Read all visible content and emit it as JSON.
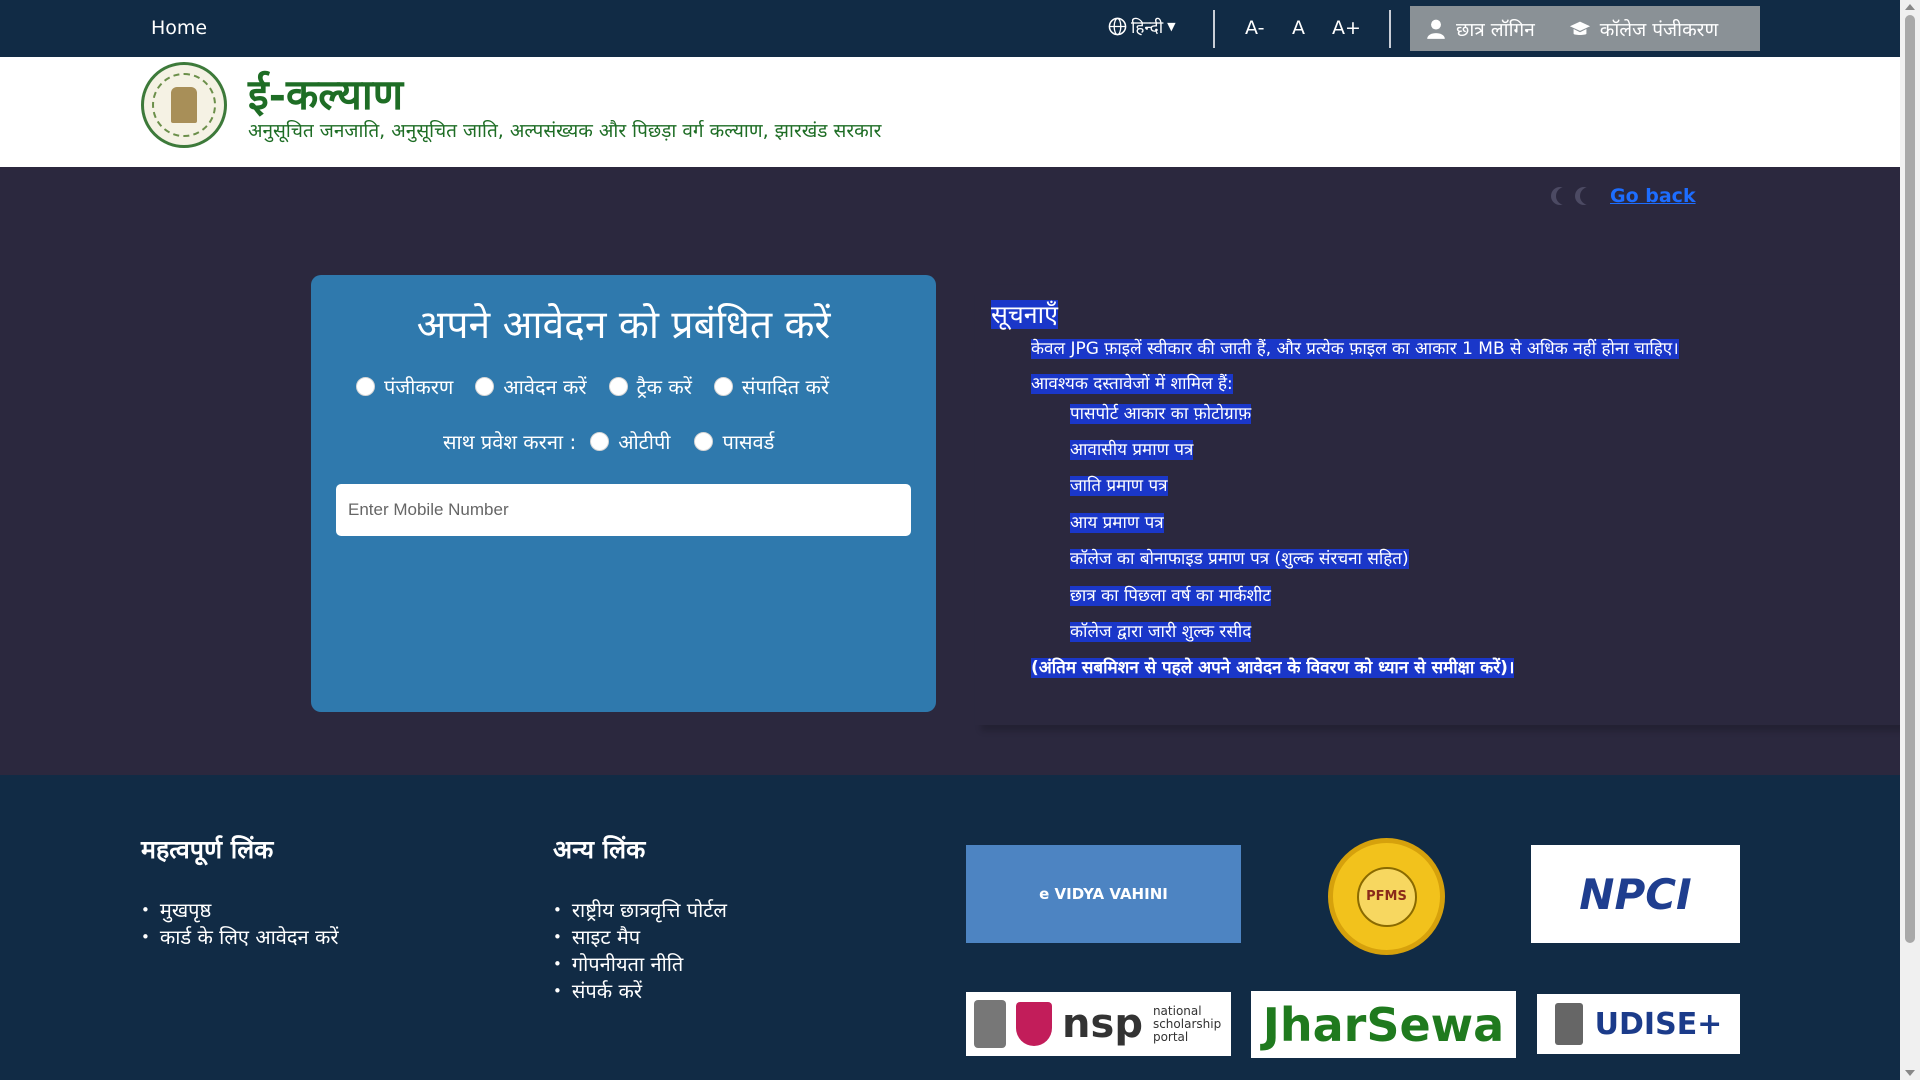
{
  "topbar": {
    "home": "Home",
    "language": "हिन्दी",
    "font_small": "A-",
    "font_normal": "A",
    "font_large": "A+",
    "student_login": "छात्र लॉगिन",
    "college_registration": "कॉलेज पंजीकरण"
  },
  "header": {
    "title": "ई-कल्याण",
    "subtitle": "अनुसूचित जनजाति, अनुसूचित जाति, अल्पसंख्यक और पिछड़ा वर्ग कल्याण, झारखंड सरकार"
  },
  "go_back": "Go back",
  "form": {
    "heading": "अपने आवेदन को प्रबंधित करें",
    "options": [
      "पंजीकरण",
      "आवेदन करें",
      "ट्रैक करें",
      "संपादित करें"
    ],
    "login_with_label": "साथ प्रवेश करना :",
    "login_options": [
      "ओटीपी",
      "पासवर्ड"
    ],
    "mobile_placeholder": "Enter Mobile Number"
  },
  "notices": {
    "heading": "सूचनाएँ",
    "file_note": "केवल JPG फ़ाइलें स्वीकार की जाती हैं, और प्रत्येक फ़ाइल का आकार 1 MB से अधिक नहीं होना चाहिए।",
    "docs_heading": "आवश्यक दस्तावेजों में शामिल हैं:",
    "documents": [
      "पासपोर्ट आकार का फ़ोटोग्राफ़",
      "आवासीय प्रमाण पत्र",
      "जाति प्रमाण पत्र",
      "आय प्रमाण पत्र",
      "कॉलेज का बोनाफाइड प्रमाण पत्र (शुल्क संरचना सहित)",
      "छात्र का पिछला वर्ष का मार्कशीट",
      "कॉलेज द्वारा जारी शुल्क रसीद"
    ],
    "final_note": "(अंतिम सबमिशन से पहले अपने आवेदन के विवरण को ध्यान से समीक्षा करें)।"
  },
  "footer": {
    "important_links_heading": "महत्वपूर्ण लिंक",
    "important_links": [
      "मुखपृष्ठ",
      "कार्ड के लिए आवेदन करें"
    ],
    "other_links_heading": "अन्य लिंक",
    "other_links": [
      "राष्ट्रीय छात्रवृत्ति पोर्टल",
      "साइट मैप",
      "गोपनीयता नीति",
      "संपर्क करें"
    ],
    "logos": {
      "evidya": "e VIDYA VAHINI",
      "pfms": "PFMS",
      "npci": "NPCI",
      "nsp": "nsp",
      "nsp_sub": "national scholarship portal",
      "jharsewa": "JharSewa",
      "udise": "UDISE+"
    }
  },
  "colors": {
    "topbar": "#112b45",
    "page_bg": "#2b283e",
    "card": "#2f79ad",
    "brand_green": "#1e6d25",
    "highlight": "#1a37c9",
    "link": "#1d6dff"
  },
  "icons": {
    "language": "globe-icon",
    "student_login": "user-icon",
    "college_registration": "graduation-cap-icon",
    "theme_toggle": "moon-icon"
  }
}
